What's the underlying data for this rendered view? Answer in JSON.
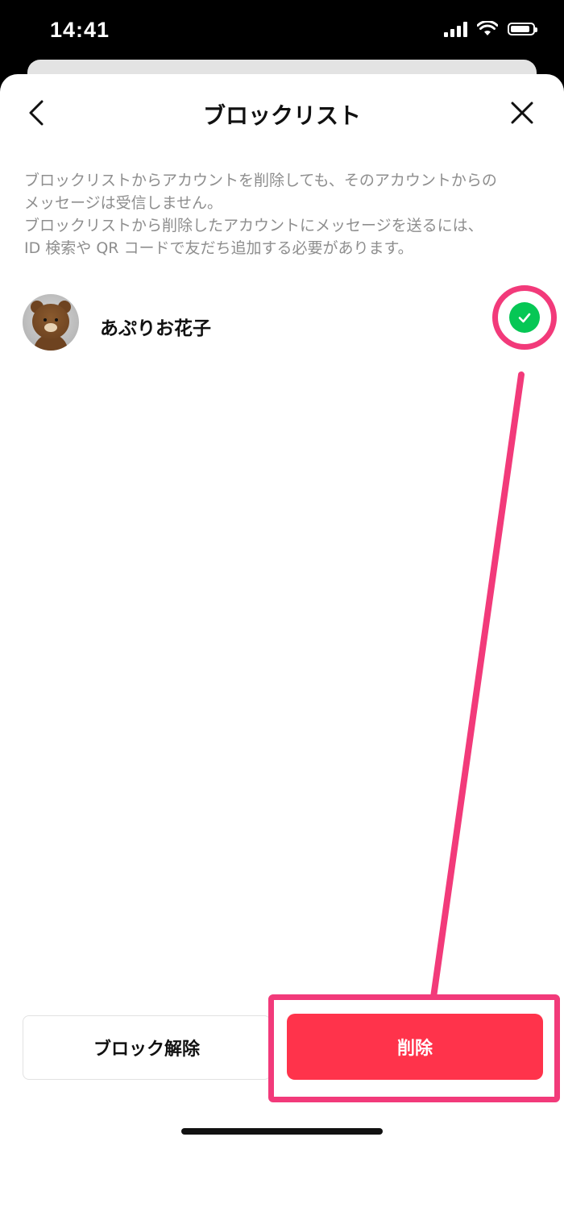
{
  "status_bar": {
    "time": "14:41"
  },
  "header": {
    "title": "ブロックリスト"
  },
  "description": "ブロックリストからアカウントを削除しても、そのアカウントからの\nメッセージは受信しません。\nブロックリストから削除したアカウントにメッセージを送るには、\nID 検索や QR コードで友だち追加する必要があります。",
  "blocked_list": [
    {
      "name": "あぷりお花子",
      "selected": true
    }
  ],
  "buttons": {
    "unblock": "ブロック解除",
    "delete": "削除"
  },
  "colors": {
    "accent_green": "#06c755",
    "delete_red": "#ff334b",
    "highlight_pink": "#f23a7a"
  }
}
